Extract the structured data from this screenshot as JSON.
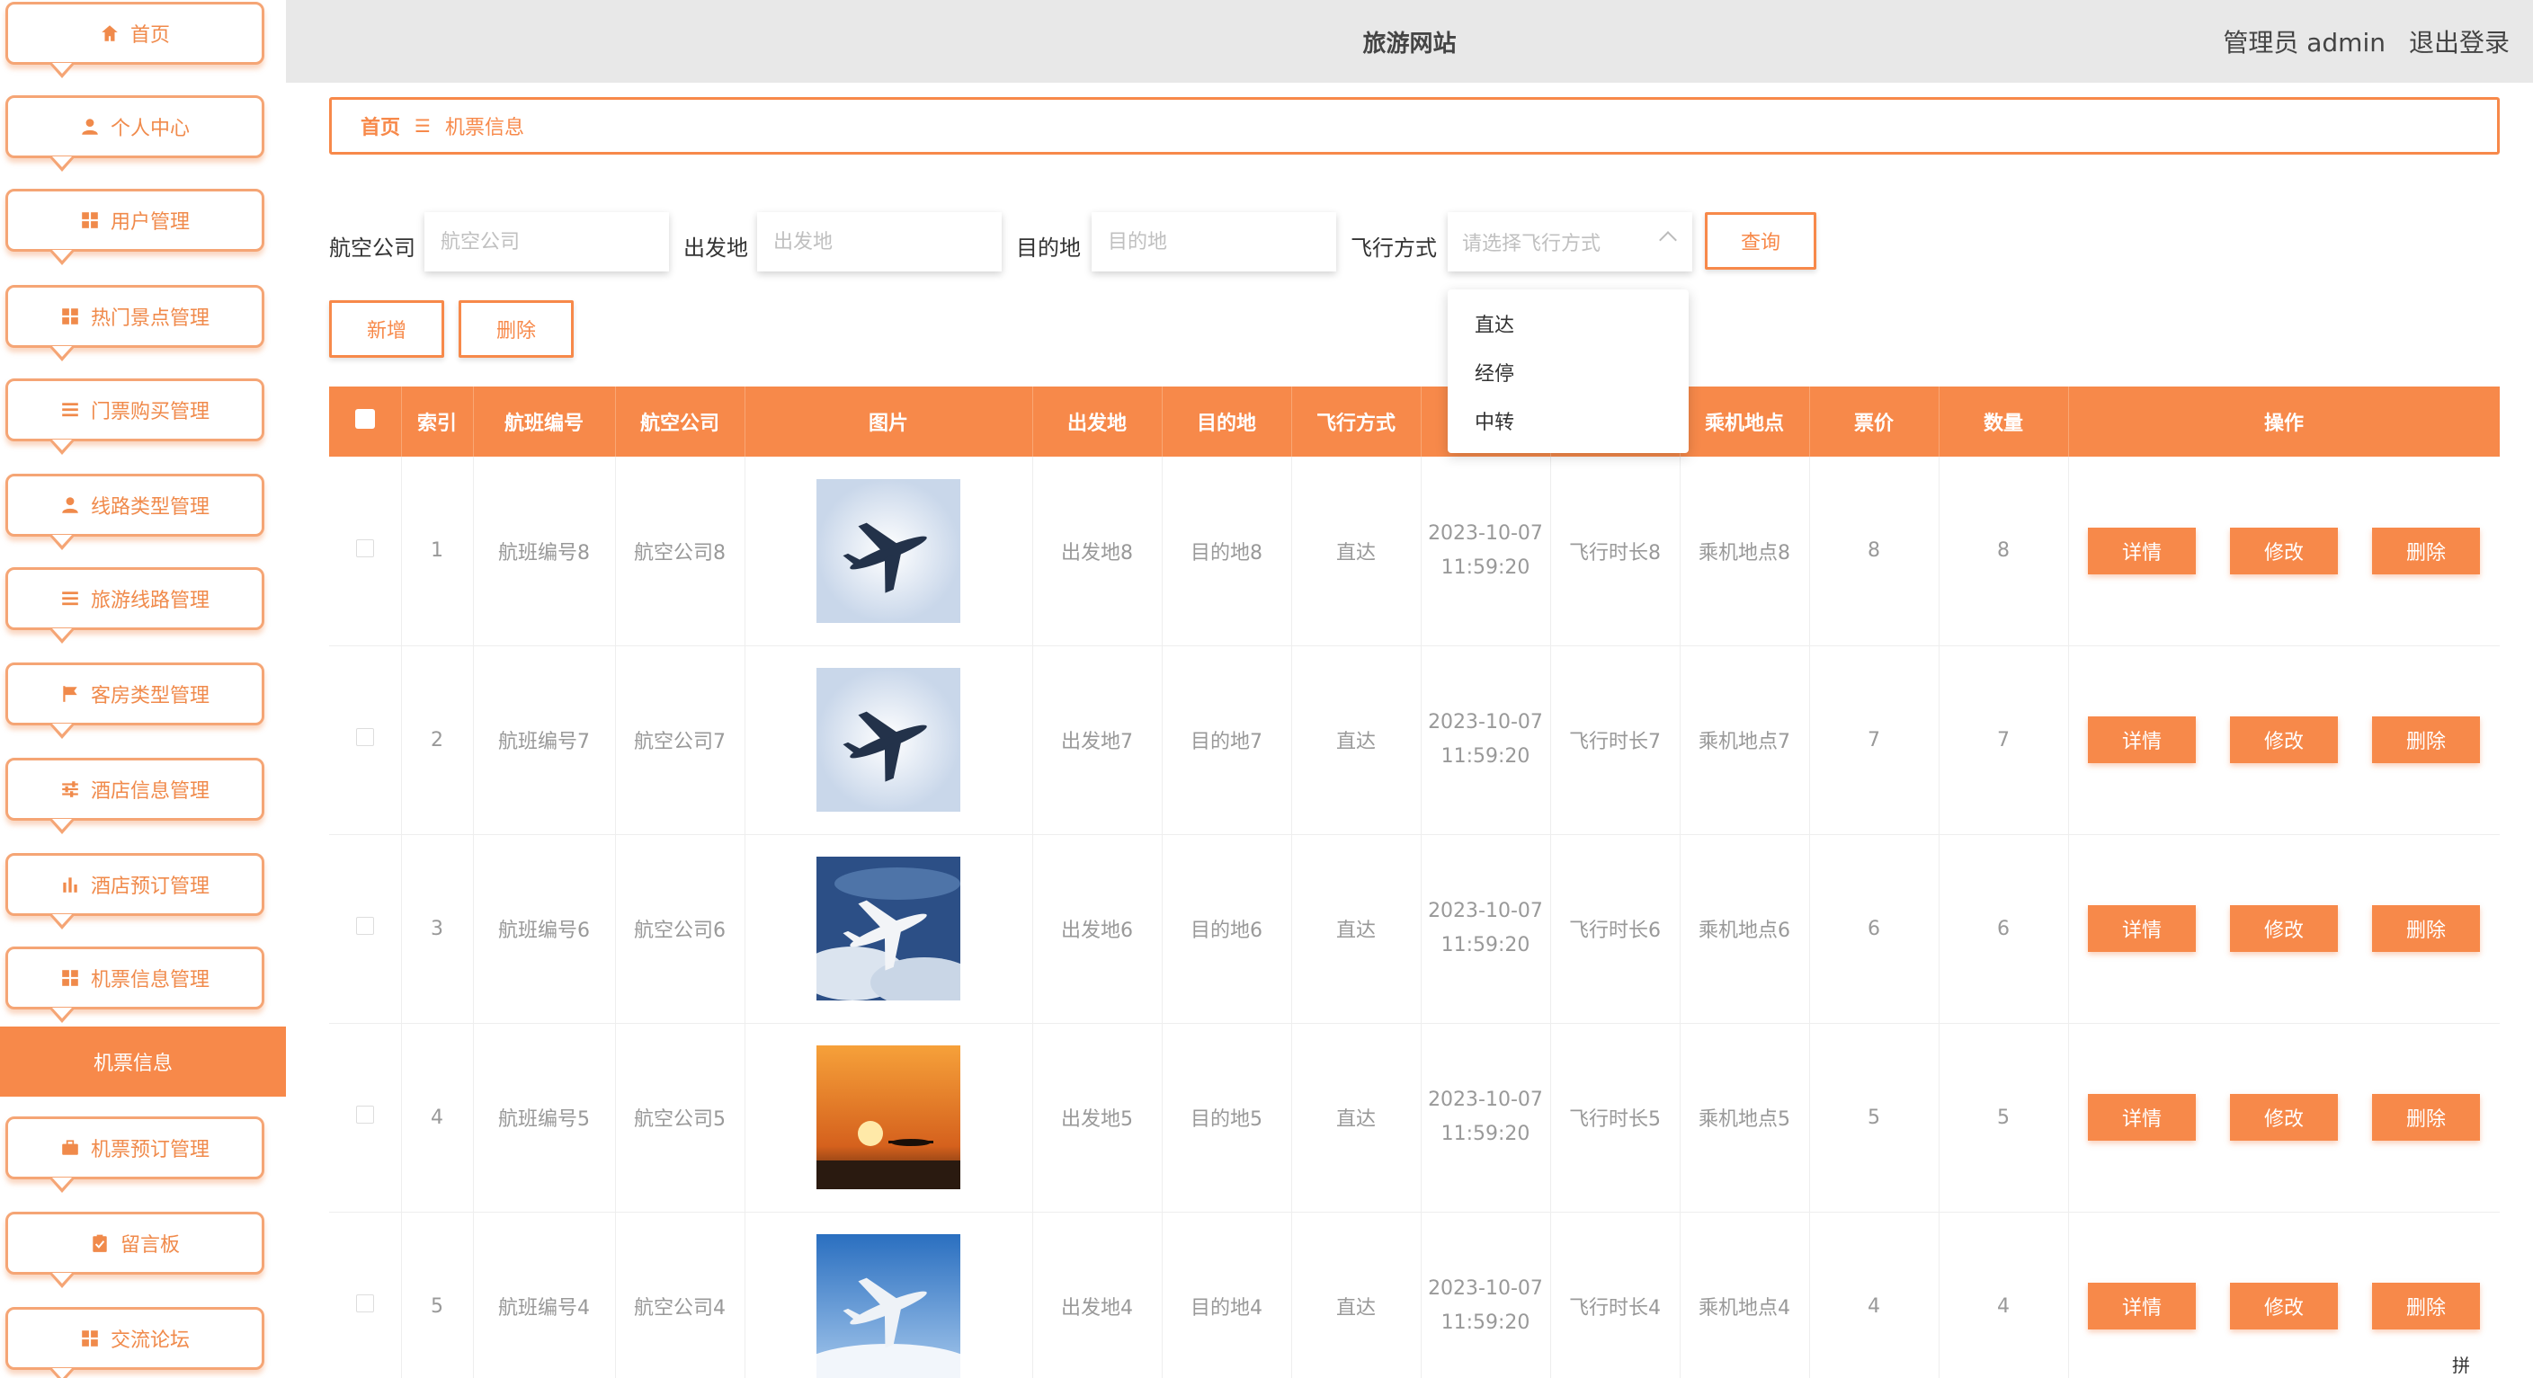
{
  "header": {
    "title": "旅游网站",
    "user": "管理员 admin",
    "logout": "退出登录"
  },
  "sidebar": {
    "items": [
      {
        "label": "首页",
        "icon": "home-icon"
      },
      {
        "label": "个人中心",
        "icon": "user-icon"
      },
      {
        "label": "用户管理",
        "icon": "grid-icon"
      },
      {
        "label": "热门景点管理",
        "icon": "grid-icon"
      },
      {
        "label": "门票购买管理",
        "icon": "list-icon"
      },
      {
        "label": "线路类型管理",
        "icon": "user-icon"
      },
      {
        "label": "旅游线路管理",
        "icon": "list-icon"
      },
      {
        "label": "客房类型管理",
        "icon": "flag-icon"
      },
      {
        "label": "酒店信息管理",
        "icon": "sliders-icon"
      },
      {
        "label": "酒店预订管理",
        "icon": "bar-chart-icon"
      },
      {
        "label": "机票信息管理",
        "icon": "grid-icon"
      },
      {
        "label": "机票预订管理",
        "icon": "briefcase-icon"
      },
      {
        "label": "留言板",
        "icon": "clipboard-icon"
      },
      {
        "label": "交流论坛",
        "icon": "grid-icon"
      }
    ],
    "active_sub": "机票信息"
  },
  "breadcrumb": {
    "home": "首页",
    "separator": "☰",
    "current": "机票信息"
  },
  "search": {
    "airline_label": "航空公司",
    "airline_placeholder": "航空公司",
    "origin_label": "出发地",
    "origin_placeholder": "出发地",
    "dest_label": "目的地",
    "dest_placeholder": "目的地",
    "mode_label": "飞行方式",
    "mode_placeholder": "请选择飞行方式",
    "query_button": "查询"
  },
  "actions": {
    "add": "新增",
    "delete": "删除"
  },
  "dropdown": {
    "options": [
      "直达",
      "经停",
      "中转"
    ]
  },
  "table": {
    "headers": [
      "索引",
      "航班编号",
      "航空公司",
      "图片",
      "出发地",
      "目的地",
      "飞行方式",
      "",
      "",
      "乘机地点",
      "票价",
      "数量",
      "操作"
    ],
    "rows": [
      {
        "index": "1",
        "flight_no": "航班编号8",
        "airline": "航空公司8",
        "image": "plane-white-sky",
        "origin": "出发地8",
        "dest": "目的地8",
        "mode": "直达",
        "time": "2023-10-07 11:59:20",
        "duration": "飞行时长8",
        "boarding": "乘机地点8",
        "price": "8",
        "qty": "8"
      },
      {
        "index": "2",
        "flight_no": "航班编号7",
        "airline": "航空公司7",
        "image": "plane-white-sky",
        "origin": "出发地7",
        "dest": "目的地7",
        "mode": "直达",
        "time": "2023-10-07 11:59:20",
        "duration": "飞行时长7",
        "boarding": "乘机地点7",
        "price": "7",
        "qty": "7"
      },
      {
        "index": "3",
        "flight_no": "航班编号6",
        "airline": "航空公司6",
        "image": "plane-clouds",
        "origin": "出发地6",
        "dest": "目的地6",
        "mode": "直达",
        "time": "2023-10-07 11:59:20",
        "duration": "飞行时长6",
        "boarding": "乘机地点6",
        "price": "6",
        "qty": "6"
      },
      {
        "index": "4",
        "flight_no": "航班编号5",
        "airline": "航空公司5",
        "image": "plane-sunset",
        "origin": "出发地5",
        "dest": "目的地5",
        "mode": "直达",
        "time": "2023-10-07 11:59:20",
        "duration": "飞行时长5",
        "boarding": "乘机地点5",
        "price": "5",
        "qty": "5"
      },
      {
        "index": "5",
        "flight_no": "航班编号4",
        "airline": "航空公司4",
        "image": "plane-blue-sky",
        "origin": "出发地4",
        "dest": "目的地4",
        "mode": "直达",
        "time": "2023-10-07 11:59:20",
        "duration": "飞行时长4",
        "boarding": "乘机地点4",
        "price": "4",
        "qty": "4"
      }
    ],
    "row_actions": {
      "detail": "详情",
      "edit": "修改",
      "delete": "删除"
    }
  },
  "colors": {
    "accent": "#f7894a",
    "header_bg": "#e8e8e8"
  },
  "ime_indicator": "拼"
}
